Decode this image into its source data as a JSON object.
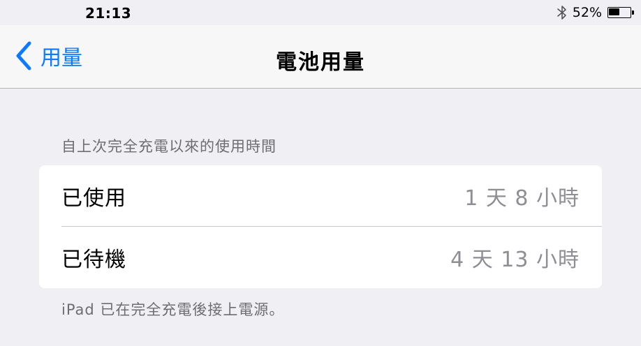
{
  "status_bar": {
    "time": "21:13",
    "battery_percent_label": "52%",
    "battery_level": 0.52,
    "bluetooth_icon": "bluetooth-icon",
    "battery_icon": "battery-icon"
  },
  "nav": {
    "back_label": "用量",
    "back_icon": "chevron-left-icon",
    "title": "電池用量"
  },
  "section": {
    "header": "自上次完全充電以來的使用時間",
    "rows": [
      {
        "label": "已使用",
        "value": "1 天 8 小時"
      },
      {
        "label": "已待機",
        "value": "4 天 13 小時"
      }
    ],
    "footer": "iPad 已在完全充電後接上電源。"
  },
  "colors": {
    "accent": "#0a7bff",
    "background": "#efeff4",
    "secondary_text": "#8e8e93"
  }
}
